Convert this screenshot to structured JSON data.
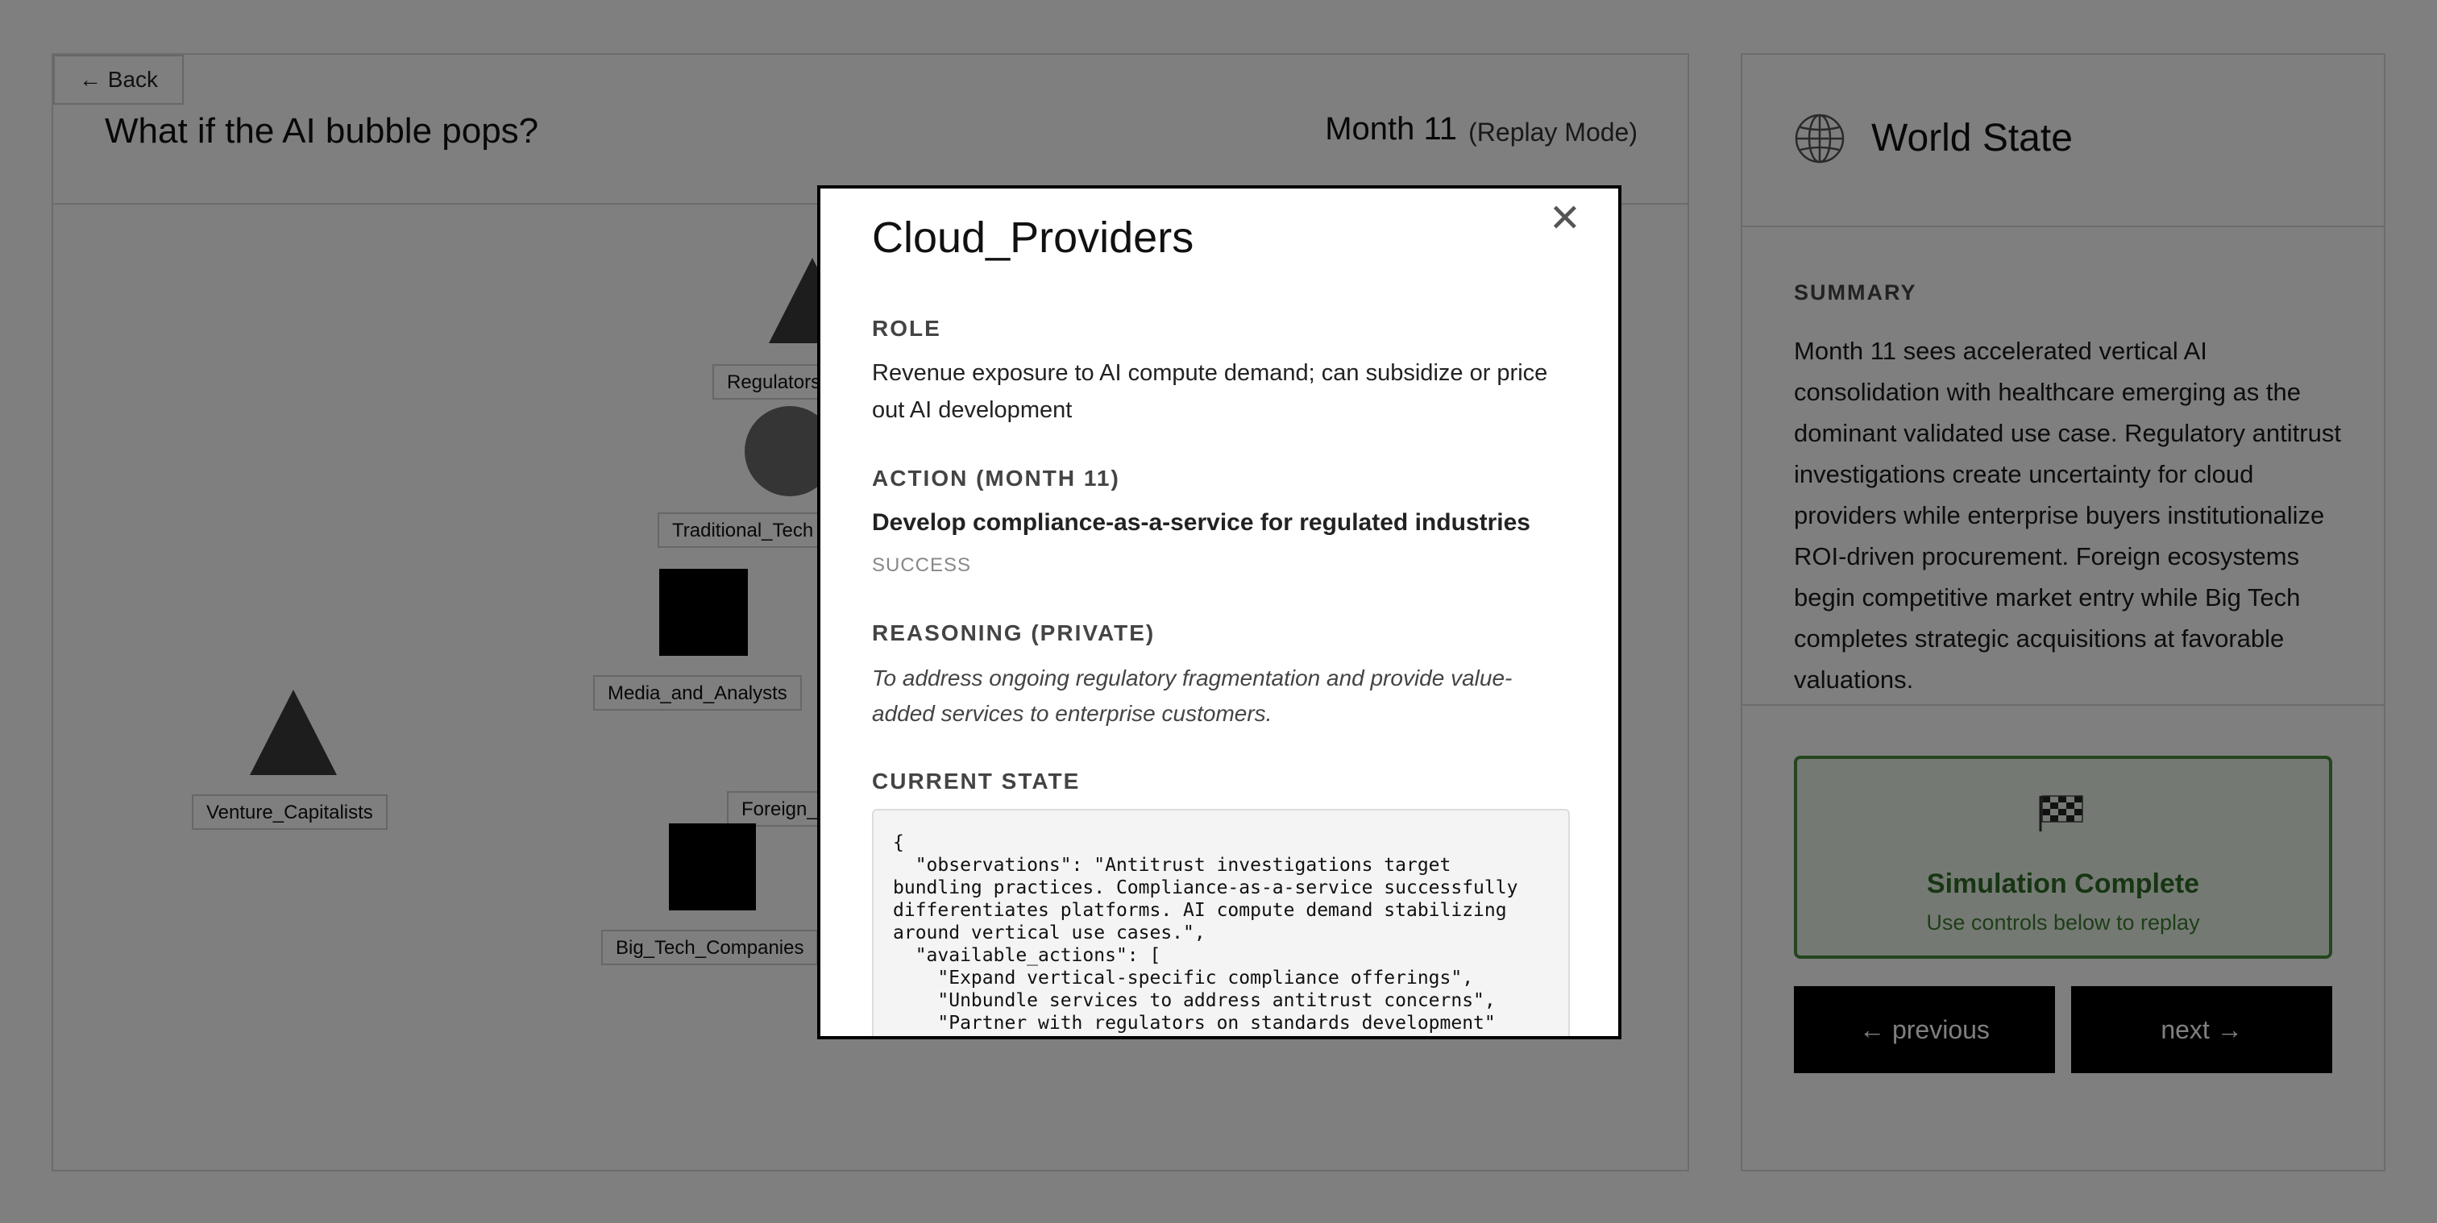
{
  "header": {
    "back_label": "← Back",
    "scenario_title": "What if the AI bubble pops?",
    "month_label": "Month 11",
    "mode_label": "(Replay Mode)"
  },
  "graph": {
    "nodes": [
      {
        "label": "Regulators",
        "shape": "triangle"
      },
      {
        "label": "Traditional_Tech",
        "shape": "circle"
      },
      {
        "label": "Media_and_Analysts",
        "shape": "square"
      },
      {
        "label": "Venture_Capitalists",
        "shape": "triangle"
      },
      {
        "label": "Foreign_",
        "shape": "triangle"
      },
      {
        "label": "Big_Tech_Companies",
        "shape": "square"
      }
    ]
  },
  "world": {
    "title": "World State",
    "summary_heading": "SUMMARY",
    "summary_text": "Month 11 sees accelerated vertical AI consolidation with healthcare emerging as the dominant validated use case. Regulatory antitrust investigations create uncertainty for cloud providers while enterprise buyers institutionalize ROI-driven procurement. Foreign ecosystems begin competitive market entry while Big Tech completes strategic acquisitions at favorable valuations.",
    "sim_title": "Simulation Complete",
    "sim_subtitle": "Use controls below to replay",
    "prev_label": "← previous",
    "next_label": "next →"
  },
  "modal": {
    "title": "Cloud_Providers",
    "close_glyph": "✕",
    "role_heading": "ROLE",
    "role_text": "Revenue exposure to AI compute demand; can subsidize or price out AI development",
    "action_heading": "ACTION (MONTH 11)",
    "action_title": "Develop compliance-as-a-service for regulated industries",
    "action_status": "SUCCESS",
    "reasoning_heading": "REASONING (PRIVATE)",
    "reasoning_text": "To address ongoing regulatory fragmentation and provide value-added services to enterprise customers.",
    "state_heading": "CURRENT STATE",
    "state_json": "{\n  \"observations\": \"Antitrust investigations target\nbundling practices. Compliance-as-a-service successfully\ndifferentiates platforms. AI compute demand stabilizing\naround vertical use cases.\",\n  \"available_actions\": [\n    \"Expand vertical-specific compliance offerings\",\n    \"Unbundle services to address antitrust concerns\",\n    \"Partner with regulators on standards development\"\n  ]\n}"
  },
  "colors": {
    "accent_green": "#4a8a3c",
    "button_black": "#000000"
  }
}
